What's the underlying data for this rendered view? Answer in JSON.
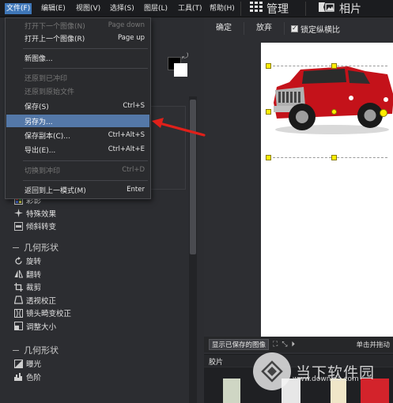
{
  "menubar": {
    "items": [
      {
        "label": "文件(F)",
        "active": true
      },
      {
        "label": "编辑(E)"
      },
      {
        "label": "视图(V)"
      },
      {
        "label": "选择(S)"
      },
      {
        "label": "图层(L)"
      },
      {
        "label": "工具(T)"
      },
      {
        "label": "帮助(H)"
      }
    ],
    "modes": [
      {
        "icon": "grid-icon",
        "label": "管理"
      },
      {
        "icon": "photo-icon",
        "label": "相片"
      }
    ]
  },
  "file_menu": {
    "items": [
      {
        "label": "打开下一个图像(N)",
        "shortcut": "Page down",
        "disabled": true
      },
      {
        "label": "打开上一个图像(R)",
        "shortcut": "Page up"
      },
      {
        "label": "新图像...",
        "shortcut": ""
      },
      {
        "label": "还原到已冲印",
        "shortcut": "",
        "disabled": true
      },
      {
        "label": "还原到原始文件",
        "shortcut": "",
        "disabled": true
      },
      {
        "label": "保存(S)",
        "shortcut": "Ctrl+S"
      },
      {
        "label": "另存为...",
        "shortcut": "",
        "highlighted": true
      },
      {
        "label": "保存副本(C)...",
        "shortcut": "Ctrl+Alt+S"
      },
      {
        "label": "导出(E)...",
        "shortcut": "Ctrl+Alt+E"
      },
      {
        "label": "切换到冲印",
        "shortcut": "Ctrl+D",
        "disabled": true
      },
      {
        "label": "返回到上一模式(M)",
        "shortcut": "Enter"
      }
    ]
  },
  "tools": {
    "group_effects": {
      "items": [
        {
          "icon": "palette-icon",
          "label": "彩影"
        },
        {
          "icon": "sparkle-icon",
          "label": "特殊效果"
        },
        {
          "icon": "tilt-shift-icon",
          "label": "倾斜转变"
        }
      ]
    },
    "geometry_1": {
      "title": "几何形状",
      "items": [
        {
          "icon": "rotate-icon",
          "label": "旋转"
        },
        {
          "icon": "flip-icon",
          "label": "翻转"
        },
        {
          "icon": "crop-icon",
          "label": "裁剪"
        },
        {
          "icon": "perspective-icon",
          "label": "透视校正"
        },
        {
          "icon": "lens-distortion-icon",
          "label": "镜头畸变校正"
        },
        {
          "icon": "resize-icon",
          "label": "调整大小"
        }
      ]
    },
    "geometry_2": {
      "title": "几何形状",
      "items": [
        {
          "icon": "exposure-icon",
          "label": "曝光"
        },
        {
          "icon": "levels-icon",
          "label": "色阶"
        }
      ]
    }
  },
  "toolbar": {
    "confirm": "确定",
    "discard": "放弃",
    "lock_aspect": "锁定纵横比",
    "lock_aspect_checked": true
  },
  "bottom": {
    "saved_button": "显示已保存的图像",
    "hint": "单击并拖动",
    "film_label": "胶片"
  },
  "watermark": {
    "brand": "当下软件园",
    "url": "www.downxia.com"
  },
  "colors": {
    "menu_highlight": "#5478a8",
    "annotation_arrow": "#e0201a",
    "handle": "#ffee00"
  }
}
